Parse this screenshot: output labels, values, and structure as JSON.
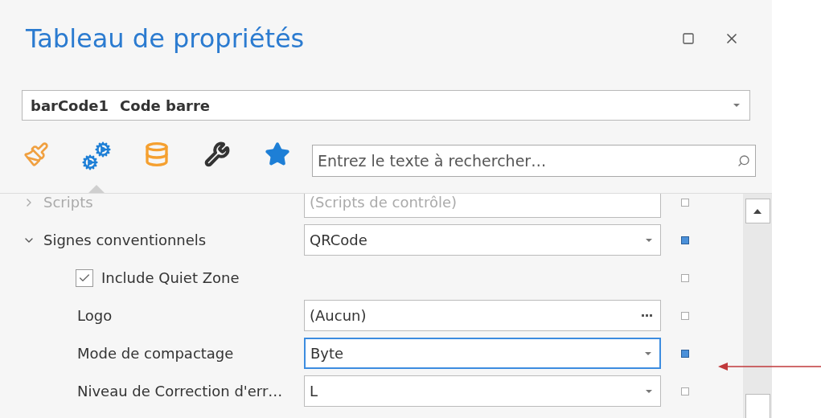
{
  "window": {
    "title": "Tableau de propriétés"
  },
  "object_selector": {
    "name": "barCode1",
    "type": "Code barre"
  },
  "tabs": [
    {
      "kind": "brush",
      "selected": false
    },
    {
      "kind": "gears",
      "selected": true
    },
    {
      "kind": "database",
      "selected": false
    },
    {
      "kind": "wrench",
      "selected": false
    },
    {
      "kind": "star",
      "selected": false
    }
  ],
  "search": {
    "placeholder": "Entrez le texte à rechercher…"
  },
  "properties": [
    {
      "kind": "category",
      "label": "Scripts",
      "expanded": false,
      "disabled": true,
      "value": "(Scripts de contrôle)",
      "modified": false,
      "selected": false
    },
    {
      "kind": "category",
      "label": "Signes conventionnels",
      "expanded": true,
      "disabled": false,
      "value": "QRCode",
      "button": {
        "kind": "dropdown"
      },
      "modified": true,
      "selected": false
    },
    {
      "kind": "checkbox",
      "label": "Include Quiet Zone",
      "checked": true,
      "modified": false
    },
    {
      "kind": "property",
      "label": "Logo",
      "disabled": false,
      "value": "(Aucun)",
      "button": {
        "kind": "ellipsis"
      },
      "modified": false,
      "selected": false
    },
    {
      "kind": "property",
      "label": "Mode de compactage",
      "disabled": false,
      "value": "Byte",
      "button": {
        "kind": "dropdown"
      },
      "modified": true,
      "selected": true
    },
    {
      "kind": "property",
      "label": "Niveau de Correction d'err…",
      "disabled": false,
      "value": "L",
      "button": {
        "kind": "dropdown"
      },
      "modified": false,
      "selected": false
    }
  ]
}
